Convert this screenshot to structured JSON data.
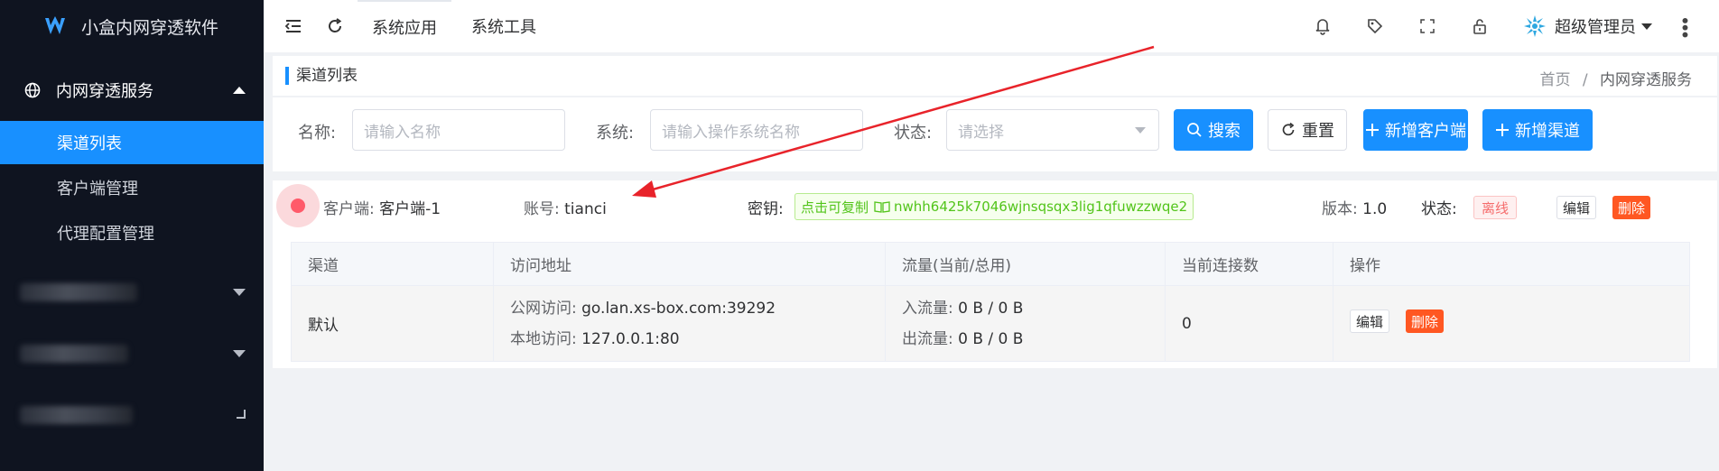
{
  "app": {
    "title": "小盒内网穿透软件"
  },
  "sidebar": {
    "group_label": "内网穿透服务",
    "items": [
      {
        "label": "渠道列表",
        "active": true
      },
      {
        "label": "客户端管理",
        "active": false
      },
      {
        "label": "代理配置管理",
        "active": false
      }
    ]
  },
  "header": {
    "links": [
      "系统应用",
      "系统工具"
    ],
    "user_name": "超级管理员"
  },
  "breadcrumb": {
    "page_title": "渠道列表",
    "home": "首页",
    "separator": "/",
    "current": "内网穿透服务"
  },
  "filter": {
    "name_label": "名称:",
    "name_placeholder": "请输入名称",
    "system_label": "系统:",
    "system_placeholder": "请输入操作系统名称",
    "status_label": "状态:",
    "status_placeholder": "请选择",
    "search_label": "搜索",
    "reset_label": "重置",
    "add_client_label": "新增客户端",
    "add_channel_label": "新增渠道"
  },
  "client": {
    "client_label": "客户端:",
    "client_value": "客户端-1",
    "account_label": "账号:",
    "account_value": "tianci",
    "key_label": "密钥:",
    "key_copy_hint": "点击可复制",
    "key_value": "nwhh6425k7046wjnsqsqx3lig1qfuwzzwqe2",
    "version_label": "版本:",
    "version_value": "1.0",
    "status_label": "状态:",
    "status_value": "离线",
    "edit_label": "编辑",
    "delete_label": "删除",
    "status_color": "#f56c6c"
  },
  "channel_table": {
    "headers": [
      "渠道",
      "访问地址",
      "流量(当前/总用)",
      "当前连接数",
      "操作"
    ],
    "rows": [
      {
        "channel": "默认",
        "public_label": "公网访问:",
        "public_value": "go.lan.xs-box.com:39292",
        "local_label": "本地访问:",
        "local_value": "127.0.0.1:80",
        "in_label": "入流量:",
        "in_value": "0 B / 0 B",
        "out_label": "出流量:",
        "out_value": "0 B / 0 B",
        "connections": "0",
        "edit_label": "编辑",
        "delete_label": "删除"
      }
    ]
  },
  "colors": {
    "primary": "#1890ff",
    "danger": "#ff5722",
    "sidebar_bg": "#0f1420",
    "annotation_arrow": "#e8232a"
  }
}
